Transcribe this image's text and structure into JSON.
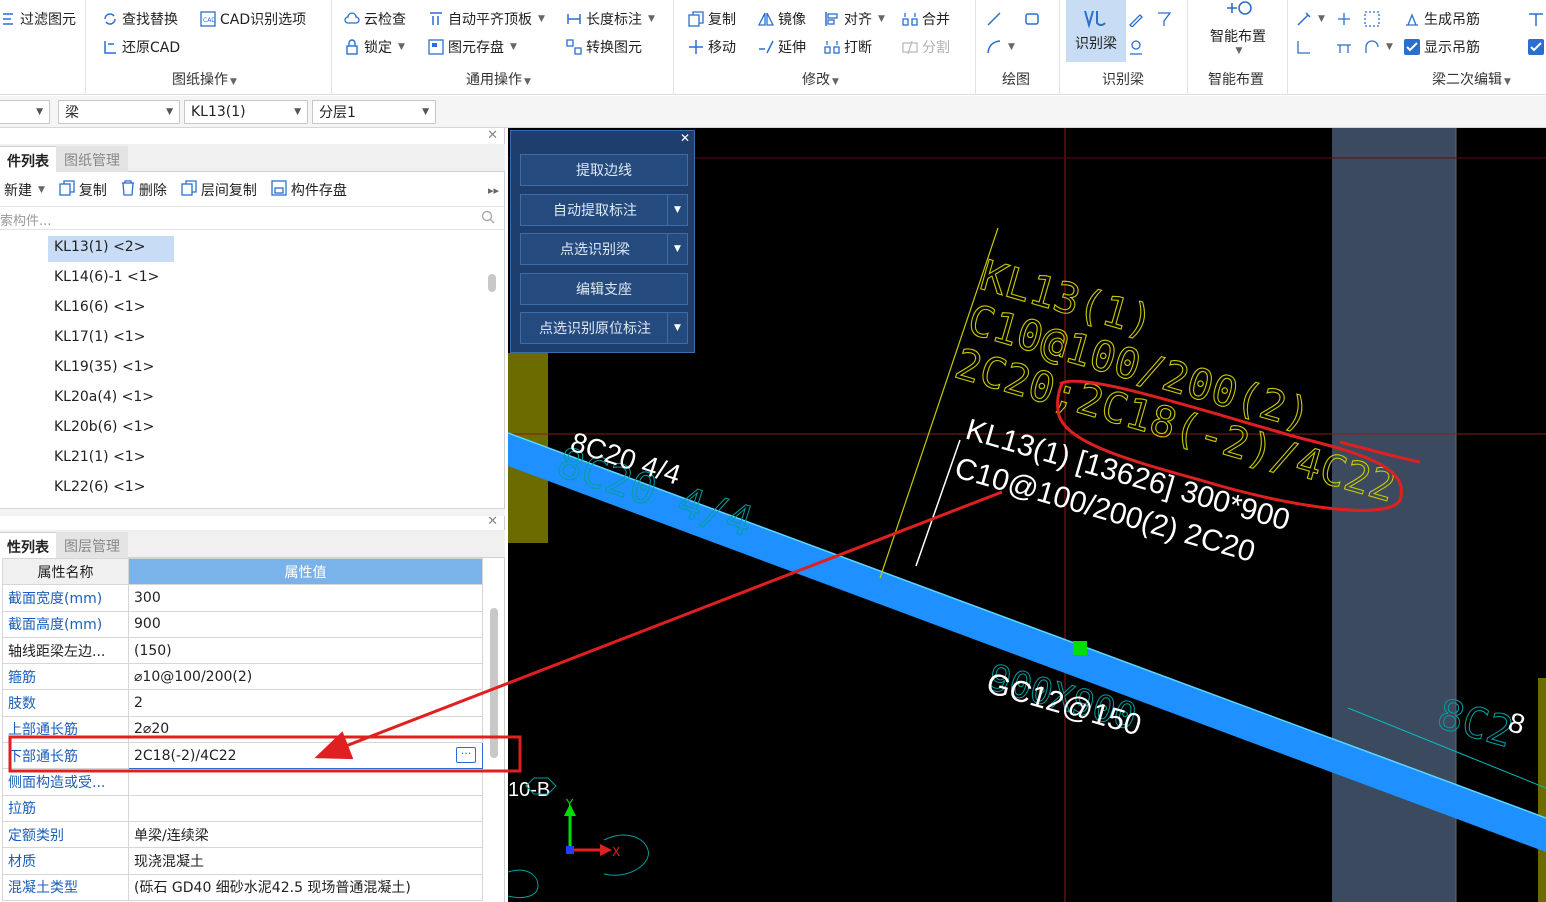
{
  "ribbon": {
    "g1": {
      "items": [
        "过滤图元",
        "查找替换",
        "CAD识别选项",
        "还原CAD"
      ],
      "label": "图纸操作"
    },
    "g2": {
      "items": [
        "云检查",
        "自动平齐顶板",
        "长度标注",
        "锁定",
        "图元存盘",
        "转换图元"
      ],
      "label": "通用操作"
    },
    "g3": {
      "items": [
        "复制",
        "镜像",
        "对齐",
        "合并",
        "移动",
        "延伸",
        "打断",
        "分割"
      ],
      "label": "修改"
    },
    "g4": {
      "label": "绘图"
    },
    "g5": {
      "main": "识别梁",
      "label": "识别梁"
    },
    "g6": {
      "main": "智能布置",
      "label": "智能布置"
    },
    "g7": {
      "items": [
        "生成吊筋",
        "显示吊筋"
      ],
      "label": "梁二次编辑"
    }
  },
  "selectors": [
    "",
    "梁",
    "KL13(1)",
    "分层1"
  ],
  "component_panel": {
    "tabs": [
      "件列表",
      "图纸管理"
    ],
    "toolbar": [
      "新建",
      "复制",
      "删除",
      "层间复制",
      "构件存盘"
    ],
    "search_placeholder": "索构件...",
    "items": [
      "KL13(1) <2>",
      "KL14(6)-1 <1>",
      "KL16(6) <1>",
      "KL17(1) <1>",
      "KL19(35) <1>",
      "KL20a(4) <1>",
      "KL20b(6) <1>",
      "KL21(1) <1>",
      "KL22(6) <1>"
    ],
    "selected_index": 0
  },
  "property_panel": {
    "tabs": [
      "性列表",
      "图层管理"
    ],
    "headers": [
      "属性名称",
      "属性值"
    ],
    "rows": [
      {
        "name": "截面宽度(mm)",
        "value": "300",
        "blue": true
      },
      {
        "name": "截面高度(mm)",
        "value": "900",
        "blue": true
      },
      {
        "name": "轴线距梁左边...",
        "value": "(150)",
        "blue": false
      },
      {
        "name": "箍筋",
        "value": "⌀10@100/200(2)",
        "blue": true
      },
      {
        "name": "肢数",
        "value": "2",
        "blue": true
      },
      {
        "name": "上部通长筋",
        "value": "2⌀20",
        "blue": true
      },
      {
        "name": "下部通长筋",
        "value": "2C18(-2)/4C22",
        "blue": true
      },
      {
        "name": "侧面构造或受...",
        "value": "",
        "blue": true
      },
      {
        "name": "拉筋",
        "value": "",
        "blue": true
      },
      {
        "name": "定额类别",
        "value": "单梁/连续梁",
        "blue": true
      },
      {
        "name": "材质",
        "value": "现浇混凝土",
        "blue": true
      },
      {
        "name": "混凝土类型",
        "value": "(砾石 GD40 细砂水泥42.5  现场普通混凝土)",
        "blue": true
      }
    ],
    "highlight_row_index": 6,
    "more_icon": "ellipsis-icon"
  },
  "float_menu": {
    "buttons": [
      {
        "label": "提取边线",
        "dropdown": false
      },
      {
        "label": "自动提取标注",
        "dropdown": true
      },
      {
        "label": "点选识别梁",
        "dropdown": true
      },
      {
        "label": "编辑支座",
        "dropdown": false
      },
      {
        "label": "点选识别原位标注",
        "dropdown": true
      }
    ]
  },
  "cad": {
    "yellow_lines": [
      "KL13(1)",
      "C10@100/200(2)",
      "2C20;2C18(-2)/4C22"
    ],
    "white_lines": [
      "KL13(1) [13626] 300*900",
      "C10@100/200(2) 2C20"
    ],
    "left_label": "8C20 4/4",
    "left_label_ghost": "8C20 4/4",
    "bottom_label": "GC12@150",
    "bottom_ghost": "900X900",
    "axis_label": "10-B",
    "right_ghost": "8C2",
    "right_white": "8",
    "colors": {
      "beam": "#1e90ff",
      "yellow": "#c8c800",
      "cyan": "#00a0a0",
      "red": "#e02020",
      "column": "#3b4a5e",
      "olive": "#6b6b00"
    }
  }
}
